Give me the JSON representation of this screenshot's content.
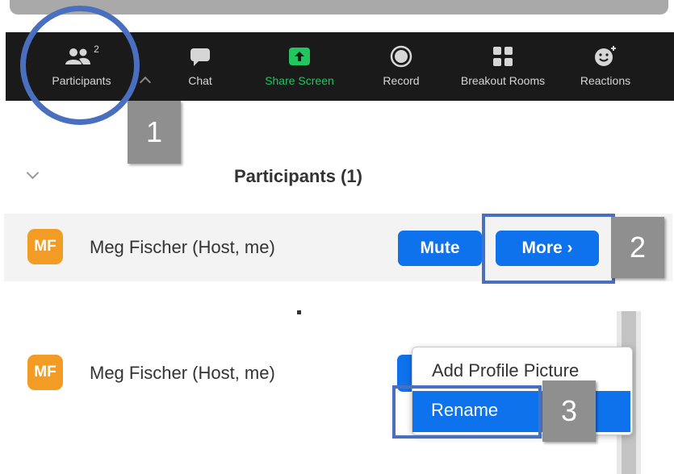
{
  "toolbar": {
    "items": [
      {
        "label": "Participants",
        "icon": "participants-icon",
        "count": "2"
      },
      {
        "label": "Chat",
        "icon": "chat-icon"
      },
      {
        "label": "Share Screen",
        "icon": "share-screen-icon"
      },
      {
        "label": "Record",
        "icon": "record-icon"
      },
      {
        "label": "Breakout Rooms",
        "icon": "breakout-rooms-icon"
      },
      {
        "label": "Reactions",
        "icon": "reactions-icon"
      }
    ]
  },
  "annotations": {
    "step1": "1",
    "step2": "2",
    "step3": "3"
  },
  "colors": {
    "accent_blue": "#0e72ed",
    "avatar_orange": "#f29c25",
    "share_green": "#22c55e",
    "annotation_blue": "#4a6fbf"
  },
  "participants": {
    "title": "Participants (1)",
    "row1": {
      "initials": "MF",
      "name": "Meg Fischer (Host, me)",
      "mute_label": "Mute",
      "more_label": "More ›"
    },
    "row2": {
      "initials": "MF",
      "name": "Meg Fischer (Host, me)"
    }
  },
  "context_menu": {
    "items": [
      "Add Profile Picture",
      "Rename"
    ]
  }
}
